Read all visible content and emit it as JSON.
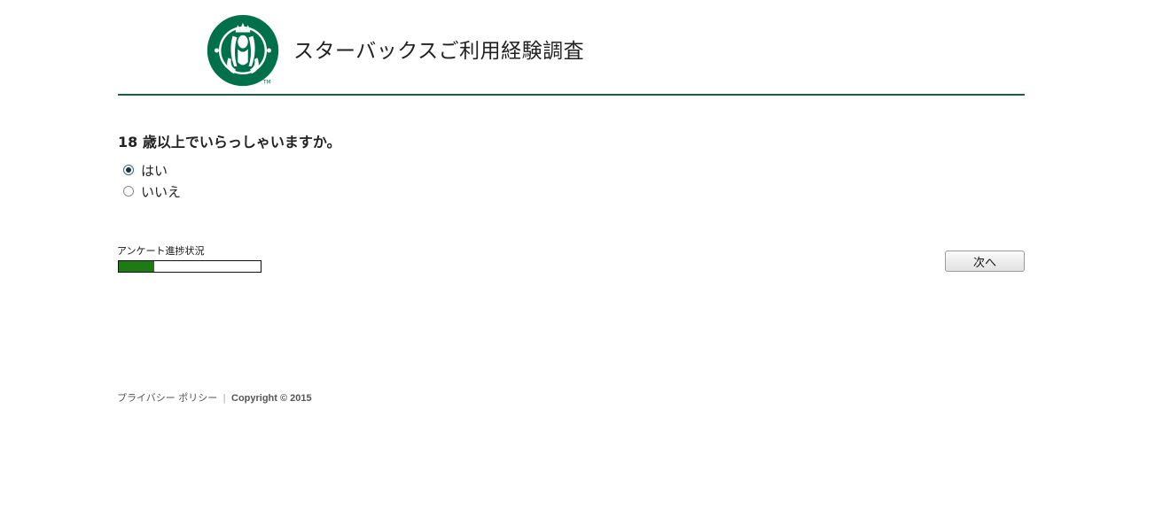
{
  "header": {
    "title": "スターバックスご利用経験調査",
    "logo_icon": "starbucks-siren-logo",
    "brand_color": "#00704a",
    "divider_color": "#1b5e45"
  },
  "survey": {
    "question": "18 歳以上でいらっしゃいますか。",
    "options": [
      {
        "label": "はい",
        "selected": true
      },
      {
        "label": "いいえ",
        "selected": false
      }
    ]
  },
  "progress": {
    "label": "アンケート進捗状況",
    "percent": 25,
    "fill_color": "#1d7a14"
  },
  "navigation": {
    "next_label": "次へ"
  },
  "footer": {
    "privacy_link": "プライバシー ポリシー",
    "separator": "|",
    "copyright": "Copyright © 2015"
  }
}
